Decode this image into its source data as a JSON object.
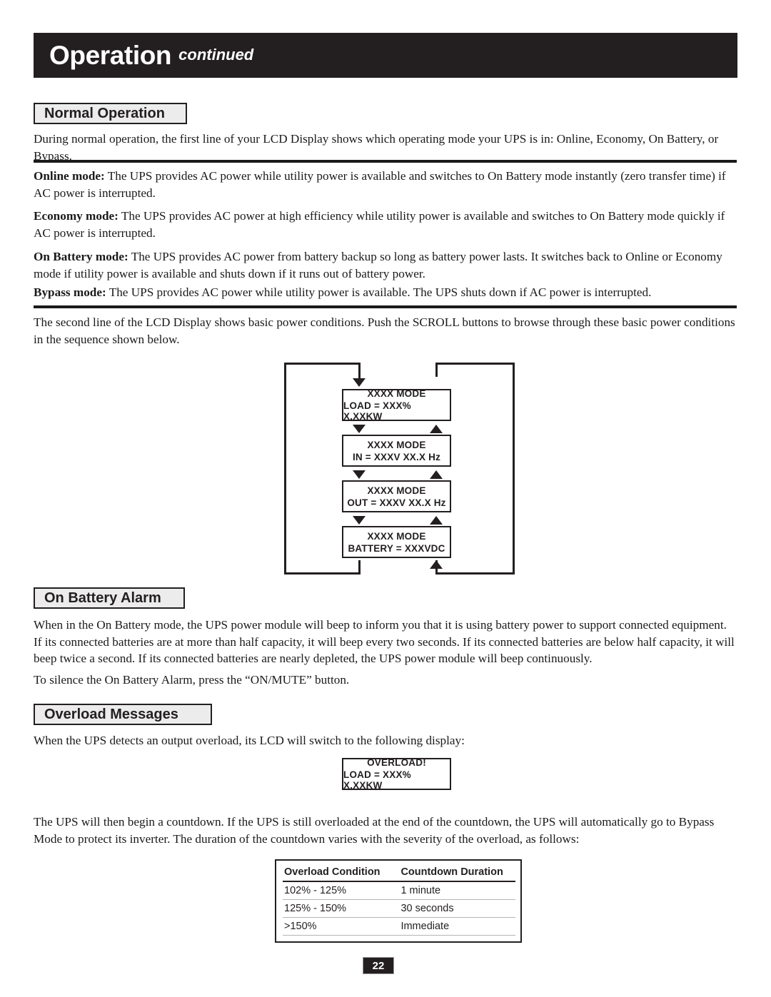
{
  "header": {
    "title": "Operation",
    "subtitle": "continued"
  },
  "sections": {
    "normal_operation": {
      "heading": "Normal Operation",
      "intro": "During normal operation, the first line of your LCD Display shows which operating mode your UPS is in: Online, Economy, On Battery, or Bypass.",
      "modes": [
        {
          "label": "Online mode:",
          "text": " The UPS provides AC power while utility power is available and switches to On Battery mode instantly (zero transfer time) if AC power is interrupted."
        },
        {
          "label": "Economy mode:",
          "text": " The UPS provides AC power at high efficiency while utility power is available and switches to On Battery mode quickly if AC power is interrupted."
        },
        {
          "label": "On Battery mode:",
          "text": " The UPS provides AC power from battery backup so long as battery power lasts. It switches back to Online or Economy mode if utility power is available and shuts down if it runs out of battery power."
        },
        {
          "label": "Bypass mode:",
          "text": " The UPS provides AC power while utility power is available. The UPS shuts down if AC power is interrupted."
        }
      ],
      "scroll_text": "The second line of the LCD Display shows basic power conditions. Push the SCROLL buttons to browse through these basic power conditions in the sequence shown below."
    },
    "on_battery_alarm": {
      "heading": "On Battery Alarm",
      "paragraph1": "When in the On Battery mode, the UPS power module will beep to inform you that it is using battery power to support connected equipment. If its connected batteries are at more than half capacity, it will beep every two seconds. If its connected batteries are below half capacity, it will beep twice a second. If its connected batteries are nearly depleted, the UPS power module will beep continuously.",
      "paragraph2": "To silence the On Battery Alarm, press the “ON/MUTE” button."
    },
    "overload_messages": {
      "heading": "Overload Messages",
      "paragraph1": "When the UPS detects an output overload, its LCD will switch to the following display:",
      "paragraph2": "The UPS will then begin a countdown. If the UPS is still overloaded at the end of the countdown, the UPS will automatically go to Bypass Mode to protect its inverter. The duration of the countdown varies with the severity of the overload, as follows:"
    }
  },
  "lcd_sequence": [
    {
      "line1": "XXXX MODE",
      "line2": "LOAD = XXX% X.XXKW"
    },
    {
      "line1": "XXXX MODE",
      "line2": "IN = XXXV XX.X Hz"
    },
    {
      "line1": "XXXX MODE",
      "line2": "OUT = XXXV XX.X Hz"
    },
    {
      "line1": "XXXX MODE",
      "line2": "BATTERY = XXXVDC"
    }
  ],
  "overload_lcd": {
    "line1": "OVERLOAD!",
    "line2": "LOAD = XXX% X.XXKW"
  },
  "overload_table": {
    "columns": [
      "Overload Condition",
      "Countdown Duration"
    ],
    "rows": [
      [
        "102% - 125%",
        "1 minute"
      ],
      [
        "125% - 150%",
        "30 seconds"
      ],
      [
        ">150%",
        "Immediate"
      ]
    ]
  },
  "footer": {
    "page_number": "22"
  }
}
